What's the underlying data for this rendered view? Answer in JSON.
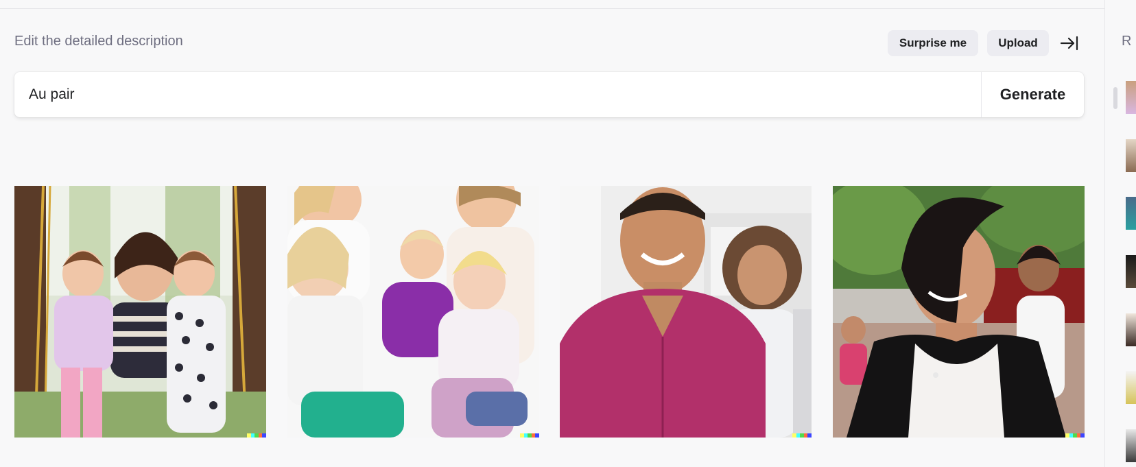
{
  "editor": {
    "label": "Edit the detailed description",
    "surprise_label": "Surprise me",
    "upload_label": "Upload",
    "collapse_icon": "arrow-right-to-bar-icon"
  },
  "prompt": {
    "value": "Au pair",
    "placeholder": "",
    "generate_label": "Generate"
  },
  "gallery": {
    "images": [
      {
        "name": "generated-image-1",
        "description": "woman with two toddlers on a swing in a park"
      },
      {
        "name": "generated-image-2",
        "description": "women sitting with three toddlers on white background"
      },
      {
        "name": "generated-image-3",
        "description": "smiling man in magenta shirt with woman behind"
      },
      {
        "name": "generated-image-4",
        "description": "woman in black blazer smiling outdoors with child"
      }
    ]
  },
  "right_panel": {
    "label": "R"
  },
  "colors": {
    "background": "#f8f8f9",
    "button_bg": "#ececf1",
    "text": "#202123",
    "muted_text": "#6e6e80"
  }
}
